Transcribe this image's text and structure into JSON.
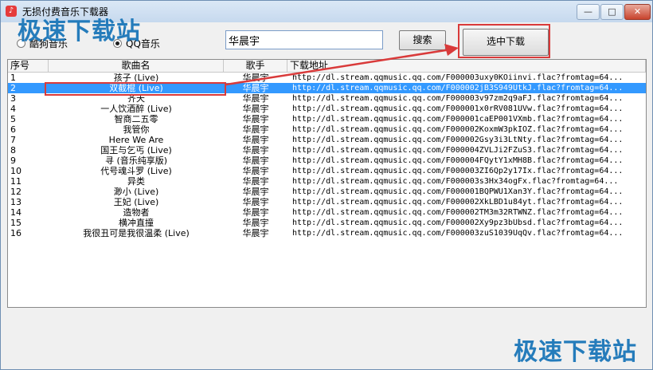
{
  "window": {
    "title": "无损付费音乐下载器",
    "icon": "music-note-icon",
    "minimize_glyph": "—",
    "maximize_glyph": "□",
    "close_glyph": "✕"
  },
  "watermark": "极速下载站",
  "source": {
    "options": [
      {
        "label": "酷狗音乐",
        "selected": false
      },
      {
        "label": "QQ音乐",
        "selected": true
      }
    ]
  },
  "search": {
    "value": "华晨宇",
    "button_label": "搜索"
  },
  "download_selected_label": "选中下载",
  "table": {
    "columns": [
      "序号",
      "歌曲名",
      "歌手",
      "下载地址"
    ],
    "selected_index": 1,
    "rows": [
      {
        "no": "1",
        "name": "孩子 (Live)",
        "artist": "华晨宇",
        "url": "http://dl.stream.qqmusic.qq.com/F000003uxy0KOiinvi.flac?fromtag=64..."
      },
      {
        "no": "2",
        "name": "双截棍 (Live)",
        "artist": "华晨宇",
        "url": "http://dl.stream.qqmusic.qq.com/F000002jB3S949UtkJ.flac?fromtag=64..."
      },
      {
        "no": "3",
        "name": "齐天",
        "artist": "华晨宇",
        "url": "http://dl.stream.qqmusic.qq.com/F000003v97zm2q9aFJ.flac?fromtag=64..."
      },
      {
        "no": "4",
        "name": "一人饮酒醉 (Live)",
        "artist": "华晨宇",
        "url": "http://dl.stream.qqmusic.qq.com/F000001x0rRV081UVw.flac?fromtag=64..."
      },
      {
        "no": "5",
        "name": "智商二五零",
        "artist": "华晨宇",
        "url": "http://dl.stream.qqmusic.qq.com/F000001caEP001VXmb.flac?fromtag=64..."
      },
      {
        "no": "6",
        "name": "我管你",
        "artist": "华晨宇",
        "url": "http://dl.stream.qqmusic.qq.com/F000002KoxmW3pkIOZ.flac?fromtag=64..."
      },
      {
        "no": "7",
        "name": "Here We Are",
        "artist": "华晨宇",
        "url": "http://dl.stream.qqmusic.qq.com/F000002Gsy3i3LtNty.flac?fromtag=64..."
      },
      {
        "no": "8",
        "name": "国王与乞丐 (Live)",
        "artist": "华晨宇",
        "url": "http://dl.stream.qqmusic.qq.com/F000004ZVLJi2FZuS3.flac?fromtag=64..."
      },
      {
        "no": "9",
        "name": "寻 (音乐纯享版)",
        "artist": "华晨宇",
        "url": "http://dl.stream.qqmusic.qq.com/F000004FQytY1xMH8B.flac?fromtag=64..."
      },
      {
        "no": "10",
        "name": "代号魂斗罗 (Live)",
        "artist": "华晨宇",
        "url": "http://dl.stream.qqmusic.qq.com/F000003ZI6Qp2y17Ix.flac?fromtag=64..."
      },
      {
        "no": "11",
        "name": "异类",
        "artist": "华晨宇",
        "url": "http://dl.stream.qqmusic.qq.com/F000003s3Hx34ogFx.flac?fromtag=64..."
      },
      {
        "no": "12",
        "name": "渺小 (Live)",
        "artist": "华晨宇",
        "url": "http://dl.stream.qqmusic.qq.com/F000001BQPWU1Xan3Y.flac?fromtag=64..."
      },
      {
        "no": "13",
        "name": "王妃 (Live)",
        "artist": "华晨宇",
        "url": "http://dl.stream.qqmusic.qq.com/F000002XkLBD1u84yt.flac?fromtag=64..."
      },
      {
        "no": "14",
        "name": "造物者",
        "artist": "华晨宇",
        "url": "http://dl.stream.qqmusic.qq.com/F000002TM3m32RTWNZ.flac?fromtag=64..."
      },
      {
        "no": "15",
        "name": "横冲直撞",
        "artist": "华晨宇",
        "url": "http://dl.stream.qqmusic.qq.com/F000002Xy9pz3bUbsd.flac?fromtag=64..."
      },
      {
        "no": "16",
        "name": "我很丑可是我很温柔 (Live)",
        "artist": "华晨宇",
        "url": "http://dl.stream.qqmusic.qq.com/F000003zuS1039UqQv.flac?fromtag=64..."
      }
    ]
  },
  "colors": {
    "selection": "#3399ff",
    "annotation": "#d93a3a",
    "watermark": "#1b76b9"
  }
}
